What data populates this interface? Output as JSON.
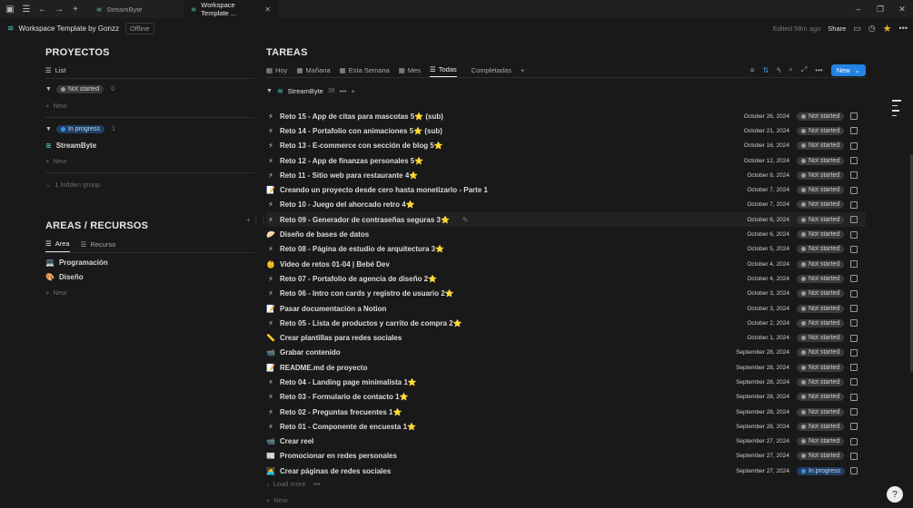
{
  "window": {
    "tabs": [
      {
        "label": "StreamByte"
      },
      {
        "label": "Workspace Template ..."
      }
    ]
  },
  "topbar": {
    "title": "Workspace Template by Gonzz",
    "offline": "Offline",
    "edited": "Edited 58m ago",
    "share": "Share"
  },
  "proyectos": {
    "heading": "PROYECTOS",
    "view": "List",
    "groups": [
      {
        "status": "Not started",
        "count": "0",
        "new": "New"
      },
      {
        "status": "In progress",
        "count": "1",
        "item": "StreamByte",
        "new": "New"
      }
    ],
    "hidden": "1 hidden group"
  },
  "areas": {
    "heading": "AREAS / RECURSOS",
    "tabs": [
      "Area",
      "Recurso"
    ],
    "items": [
      "Programación",
      "Diseño"
    ],
    "new": "New"
  },
  "tareas": {
    "heading": "TAREAS",
    "views": [
      "Hoy",
      "Mañana",
      "Esta Semana",
      "Mes",
      "Todas",
      "Completadas"
    ],
    "active_view": "Todas",
    "new_button": "New",
    "group": {
      "name": "StreamByte",
      "count": "38"
    },
    "load_more": "Load more",
    "new_row": "New",
    "rows": [
      {
        "emoji": "⚡",
        "title": "Reto 15 - App de citas para mascotas 5⭐ (sub)",
        "date": "October 26, 2024",
        "status": "Not started"
      },
      {
        "emoji": "⚡",
        "title": "Reto 14 - Portafolio con animaciones 5⭐ (sub)",
        "date": "October 21, 2024",
        "status": "Not started"
      },
      {
        "emoji": "⚡",
        "title": "Reto 13 - E-commerce con sección de blog 5⭐",
        "date": "October 16, 2024",
        "status": "Not started"
      },
      {
        "emoji": "⚡",
        "title": "Reto 12 - App de finanzas personales 5⭐",
        "date": "October 12, 2024",
        "status": "Not started"
      },
      {
        "emoji": "⚡",
        "title": "Reto 11 - Sitio web para restaurante 4⭐",
        "date": "October 8, 2024",
        "status": "Not started"
      },
      {
        "emoji": "📝",
        "title": "Creando un proyecto desde cero hasta monetizarlo - Parte 1",
        "date": "October 7, 2024",
        "status": "Not started"
      },
      {
        "emoji": "⚡",
        "title": "Reto 10 - Juego del ahorcado retro 4⭐",
        "date": "October 7, 2024",
        "status": "Not started"
      },
      {
        "emoji": "⚡",
        "title": "Reto 09 - Generador de contraseñas seguras 3⭐",
        "date": "October 6, 2024",
        "status": "Not started"
      },
      {
        "emoji": "🥟",
        "title": "Diseño de bases de datos",
        "date": "October 6, 2024",
        "status": "Not started"
      },
      {
        "emoji": "⚡",
        "title": "Reto 08 - Página de estudio de arquitectura 3⭐",
        "date": "October 5, 2024",
        "status": "Not started"
      },
      {
        "emoji": "👶",
        "title": "Video de retos 01-04 | Bebé Dev",
        "date": "October 4, 2024",
        "status": "Not started"
      },
      {
        "emoji": "⚡",
        "title": "Reto 07 - Portafolio de agencia de diseño 2⭐",
        "date": "October 4, 2024",
        "status": "Not started"
      },
      {
        "emoji": "⚡",
        "title": "Reto 06 - Intro con cards y registro de usuario 2⭐",
        "date": "October 3, 2024",
        "status": "Not started"
      },
      {
        "emoji": "📝",
        "title": "Pasar documentación a Notion",
        "date": "October 3, 2024",
        "status": "Not started"
      },
      {
        "emoji": "⚡",
        "title": "Reto 05 - Lista de productos y carrito de compra 2⭐",
        "date": "October 2, 2024",
        "status": "Not started"
      },
      {
        "emoji": "📏",
        "title": "Crear plantillas para redes sociales",
        "date": "October 1, 2024",
        "status": "Not started"
      },
      {
        "emoji": "📹",
        "title": "Grabar contenido",
        "date": "September 28, 2024",
        "status": "Not started"
      },
      {
        "emoji": "📝",
        "title": "README.md de proyecto",
        "date": "September 28, 2024",
        "status": "Not started"
      },
      {
        "emoji": "⚡",
        "title": "Reto 04 - Landing page minimalista 1⭐",
        "date": "September 28, 2024",
        "status": "Not started"
      },
      {
        "emoji": "⚡",
        "title": "Reto 03 - Formulario de contacto 1⭐",
        "date": "September 28, 2024",
        "status": "Not started"
      },
      {
        "emoji": "⚡",
        "title": "Reto 02 - Preguntas frecuentes 1⭐",
        "date": "September 28, 2024",
        "status": "Not started"
      },
      {
        "emoji": "⚡",
        "title": "Reto 01 - Componente de encuesta 1⭐",
        "date": "September 28, 2024",
        "status": "Not started"
      },
      {
        "emoji": "📹",
        "title": "Crear reel",
        "date": "September 27, 2024",
        "status": "Not started"
      },
      {
        "emoji": "📰",
        "title": "Promocionar en redes personales",
        "date": "September 27, 2024",
        "status": "Not started"
      },
      {
        "emoji": "🧑‍💻",
        "title": "Crear páginas de redes sociales",
        "date": "September 27, 2024",
        "status": "In progress"
      }
    ]
  },
  "colors": {
    "accent": "#2383e2",
    "star": "#e6b325",
    "pill_gray": "#3a3a3a",
    "pill_blue": "#1f3f63"
  }
}
